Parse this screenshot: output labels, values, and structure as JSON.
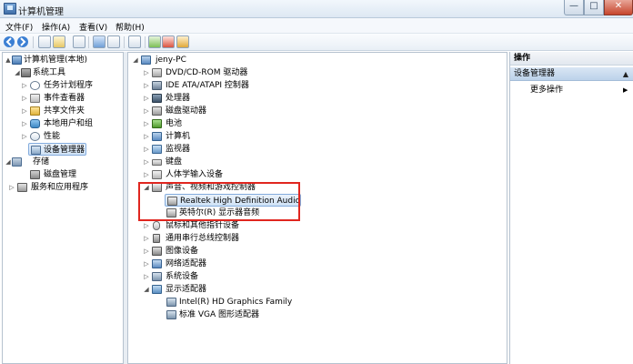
{
  "window": {
    "title": "计算机管理",
    "buttons": {
      "minimize": "—",
      "maximize": "□",
      "close": "✕"
    }
  },
  "menu": [
    "文件(F)",
    "操作(A)",
    "查看(V)",
    "帮助(H)"
  ],
  "left_tree": [
    {
      "label": "计算机管理(本地)",
      "icon": "computer-icon",
      "expander": "▲"
    },
    {
      "label": "系统工具",
      "icon": "tools-icon",
      "expander": "◢"
    },
    {
      "label": "任务计划程序",
      "icon": "clock-icon",
      "expander": "▷"
    },
    {
      "label": "事件查看器",
      "icon": "event-log-icon",
      "expander": "▷"
    },
    {
      "label": "共享文件夹",
      "icon": "shared-folder-icon",
      "expander": "▷"
    },
    {
      "label": "本地用户和组",
      "icon": "users-icon",
      "expander": "▷"
    },
    {
      "label": "性能",
      "icon": "performance-icon",
      "expander": "▷"
    },
    {
      "label": "设备管理器",
      "icon": "device-manager-icon",
      "expander": ""
    },
    {
      "label": "存储",
      "icon": "storage-icon",
      "expander": "◢"
    },
    {
      "label": "磁盘管理",
      "icon": "disk-icon",
      "expander": ""
    },
    {
      "label": "服务和应用程序",
      "icon": "services-icon",
      "expander": "▷"
    }
  ],
  "device_tree": {
    "root": "jeny-PC",
    "categories": [
      {
        "label": "DVD/CD-ROM 驱动器",
        "icon": "dvd-icon"
      },
      {
        "label": "IDE ATA/ATAPI 控制器",
        "icon": "ide-icon"
      },
      {
        "label": "处理器",
        "icon": "cpu-icon"
      },
      {
        "label": "磁盘驱动器",
        "icon": "disk-drive-icon"
      },
      {
        "label": "电池",
        "icon": "battery-icon"
      },
      {
        "label": "计算机",
        "icon": "computer-icon"
      },
      {
        "label": "监视器",
        "icon": "monitor-icon"
      },
      {
        "label": "键盘",
        "icon": "keyboard-icon"
      },
      {
        "label": "人体学输入设备",
        "icon": "hid-icon"
      },
      {
        "label": "声音、视频和游戏控制器",
        "icon": "sound-icon",
        "expanded": true,
        "children": [
          "Realtek High Definition Audio",
          "英特尔(R) 显示器音频"
        ]
      },
      {
        "label": "鼠标和其他指针设备",
        "icon": "mouse-icon"
      },
      {
        "label": "通用串行总线控制器",
        "icon": "usb-icon"
      },
      {
        "label": "图像设备",
        "icon": "camera-icon"
      },
      {
        "label": "网络适配器",
        "icon": "network-icon"
      },
      {
        "label": "系统设备",
        "icon": "system-device-icon"
      },
      {
        "label": "显示适配器",
        "icon": "display-adapter-icon",
        "expanded": true,
        "children": [
          "Intel(R) HD Graphics Family",
          "标准 VGA 图形适配器"
        ]
      }
    ]
  },
  "actions": {
    "header": "操作",
    "section": "设备管理器",
    "section_arrow": "▲",
    "more": "更多操作",
    "more_arrow": "▶"
  },
  "colors": {
    "highlight_border": "#e0261f",
    "selection": "#cfe2f6"
  }
}
